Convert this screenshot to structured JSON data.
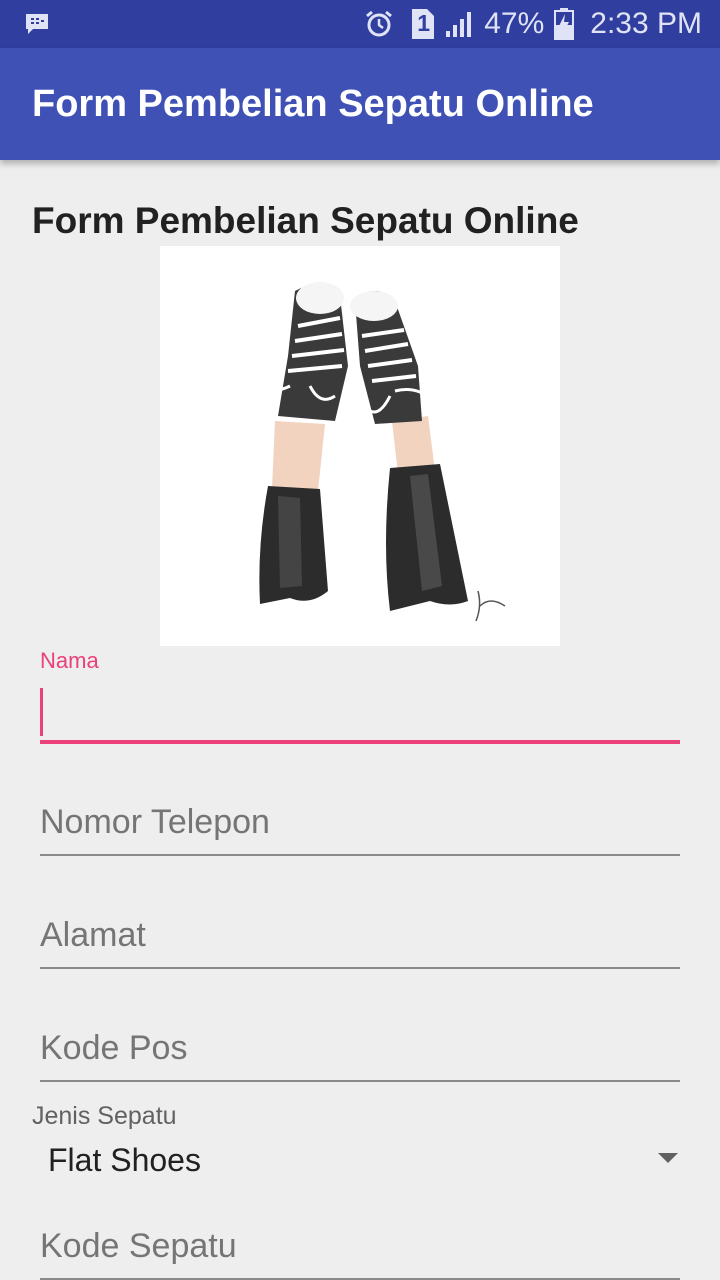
{
  "status_bar": {
    "battery": "47%",
    "time": "2:33 PM",
    "sim": "1",
    "icons": [
      "bbm-icon",
      "alarm-icon",
      "sim-icon",
      "signal-icon",
      "battery-icon"
    ]
  },
  "app_bar": {
    "title": "Form Pembelian Sepatu Online"
  },
  "form": {
    "heading": "Form Pembelian Sepatu Online",
    "image": "sneakers-illustration",
    "nama": {
      "label": "Nama",
      "value": ""
    },
    "telepon": {
      "placeholder": "Nomor Telepon"
    },
    "alamat": {
      "placeholder": "Alamat"
    },
    "kode_pos": {
      "placeholder": "Kode Pos"
    },
    "jenis_sepatu": {
      "label": "Jenis Sepatu",
      "selected": "Flat Shoes"
    },
    "kode_sepatu": {
      "placeholder": "Kode Sepatu"
    }
  },
  "colors": {
    "status_bar": "#303f9f",
    "app_bar": "#3f51b5",
    "accent": "#ec407a",
    "background": "#eeeeee"
  }
}
